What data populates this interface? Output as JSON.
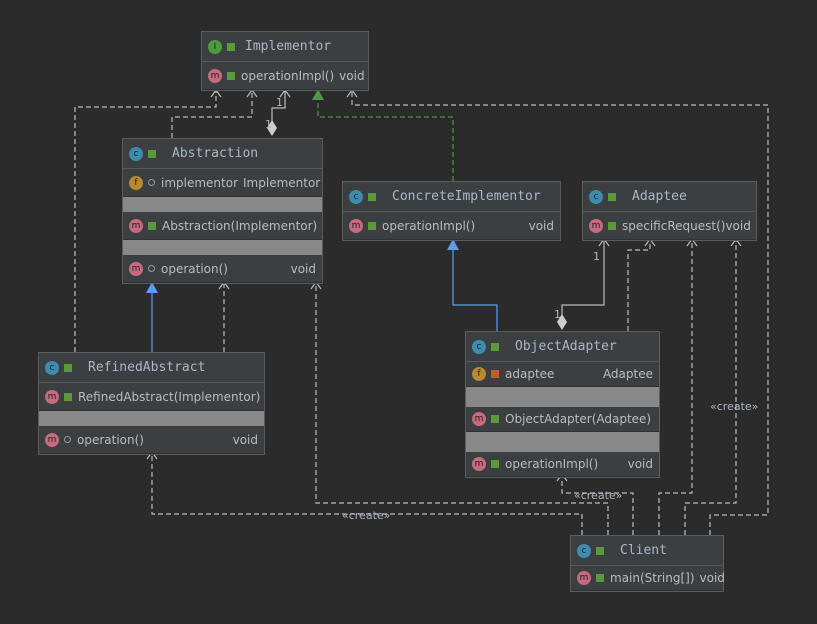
{
  "classes": {
    "implementor": {
      "name": "Implementor",
      "kind": "interface",
      "methods": [
        {
          "name": "operationImpl()",
          "type": "void"
        }
      ]
    },
    "abstraction": {
      "name": "Abstraction",
      "kind": "abstract-class",
      "fields": [
        {
          "name": "implementor",
          "type": "Implementor"
        }
      ],
      "ctors": [
        {
          "name": "Abstraction(Implementor)"
        }
      ],
      "methods": [
        {
          "name": "operation()",
          "type": "void"
        }
      ]
    },
    "concrete": {
      "name": "ConcreteImplementor",
      "kind": "class",
      "methods": [
        {
          "name": "operationImpl()",
          "type": "void"
        }
      ]
    },
    "adaptee": {
      "name": "Adaptee",
      "kind": "class",
      "methods": [
        {
          "name": "specificRequest()",
          "type": "void"
        }
      ]
    },
    "refined": {
      "name": "RefinedAbstract",
      "kind": "class",
      "ctors": [
        {
          "name": "RefinedAbstract(Implementor)"
        }
      ],
      "methods": [
        {
          "name": "operation()",
          "type": "void"
        }
      ]
    },
    "objectAdapter": {
      "name": "ObjectAdapter",
      "kind": "class",
      "fields": [
        {
          "name": "adaptee",
          "type": "Adaptee"
        }
      ],
      "ctors": [
        {
          "name": "ObjectAdapter(Adaptee)"
        }
      ],
      "methods": [
        {
          "name": "operationImpl()",
          "type": "void"
        }
      ]
    },
    "client": {
      "name": "Client",
      "kind": "class",
      "methods": [
        {
          "name": "main(String[])",
          "type": "void"
        }
      ]
    }
  },
  "labels": {
    "create": "«create»",
    "one": "1"
  },
  "colors": {
    "background": "#2b2b2b",
    "realization": "#4e9a3f",
    "inheritance": "#589df6",
    "dependency": "#bbbbbb"
  }
}
